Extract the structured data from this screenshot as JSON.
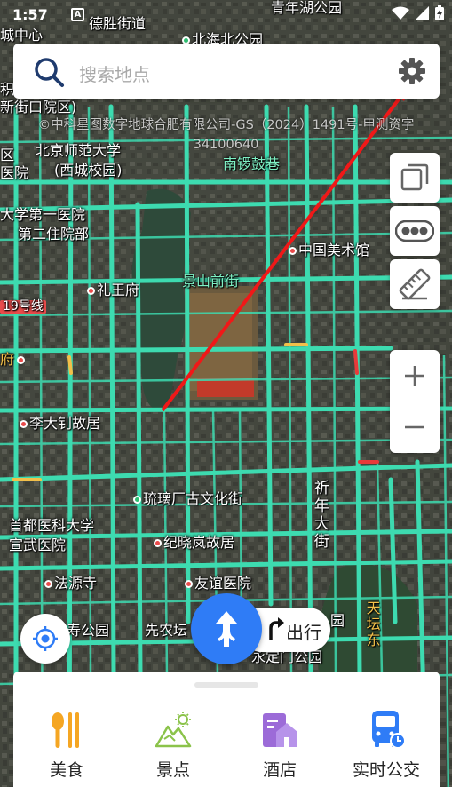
{
  "status_bar": {
    "time": "1:57",
    "notification_badge": "A"
  },
  "search": {
    "placeholder": "搜索地点"
  },
  "map": {
    "copyright_line1": "©中科星图数字地球合肥有限公司-GS（2024）1491号-甲测资字",
    "copyright_line2": "34100640",
    "labels": {
      "deshengjiedao": "德胜街道",
      "beihaibeigongyuan": "北海北公园",
      "qingnianhu": "青年湖公园",
      "chengzhongxin": "城中心",
      "jiqu": "积",
      "xiedaoqu": "新街口院区)",
      "xi": "区",
      "bnu": "北京师范大学",
      "bnu_campus": "(西城校园)",
      "yiyuan": "医院",
      "nanluoguxiang": "南锣鼓巷",
      "diyiyiyuan": "大学第一医院",
      "dierzhuyuanbu": "第二住院部",
      "meishuguan": "中国美术馆",
      "liwangfu": "礼王府",
      "jingshanqianjie": "景山前街",
      "line19": "19号线",
      "fu": "府",
      "lidazhao": "李大钊故居",
      "liulichang": "琉璃厂古文化街",
      "xinhua": "祈年大街",
      "capital_med": "首都医科大学",
      "xuanwu": "宣武医院",
      "jixiaolan": "纪晓岚故居",
      "fayuansi": "法源寺",
      "youyi": "友谊医院",
      "shougongyuan": "寿公园",
      "xiannongtan": "先农坛",
      "yongdingmen": "永定门公园",
      "tiantan": "天坛东",
      "yuan": "园"
    }
  },
  "tools": {
    "layers_icon": "layers-icon",
    "traffic_icon": "traffic-icon",
    "ruler_icon": "ruler-icon",
    "zoom_in": "+",
    "zoom_out": "−"
  },
  "go_button": {
    "label": "出行"
  },
  "categories": [
    {
      "label": "美食",
      "icon": "food-icon",
      "color": "#f5a623"
    },
    {
      "label": "景点",
      "icon": "scenery-icon",
      "color": "#8bc34a"
    },
    {
      "label": "酒店",
      "icon": "hotel-icon",
      "color": "#9c6bd8"
    },
    {
      "label": "实时公交",
      "icon": "bus-icon",
      "color": "#2f7cf6"
    }
  ],
  "colors": {
    "accent": "#2f7cf6",
    "road": "#3ddbb0",
    "arrow": "#f01818"
  }
}
